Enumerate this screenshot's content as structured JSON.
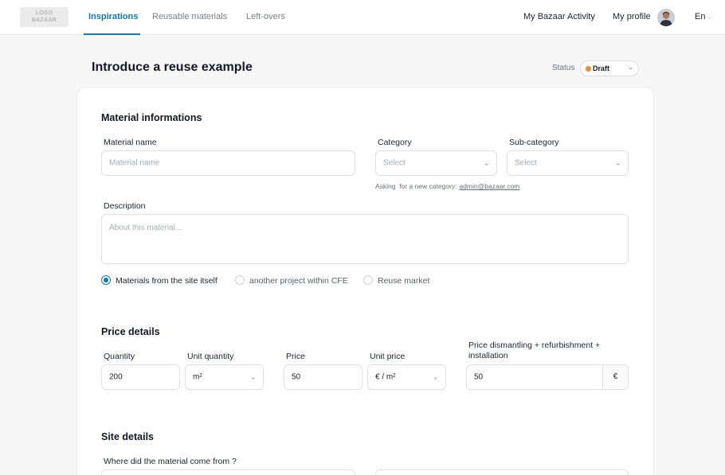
{
  "logo": {
    "line1": "LOGO",
    "line2": "BAZAAR"
  },
  "nav": {
    "tabs": [
      {
        "label": "Inspirations",
        "active": true
      },
      {
        "label": "Reusable materials",
        "active": false
      },
      {
        "label": "Left-overs",
        "active": false
      }
    ],
    "activity": "My Bazaar Activity",
    "profile": "My profile",
    "language": "En"
  },
  "page": {
    "title": "Introduce a reuse example",
    "status_label": "Status",
    "status_value": "Draft",
    "status_color": "#f08a2a"
  },
  "material": {
    "section_title": "Material informations",
    "name_label": "Material name",
    "name_placeholder": "Material name",
    "category_label": "Category",
    "category_placeholder": "Select",
    "subcategory_label": "Sub-category",
    "subcategory_placeholder": "Select",
    "hint_text": "Asking  for a new category:",
    "hint_email": "admin@bazaar.com",
    "description_label": "Description",
    "description_placeholder": "About this material...",
    "origin_options": [
      {
        "label": "Materials from the site itself",
        "checked": true
      },
      {
        "label": "another project within CFE",
        "checked": false
      },
      {
        "label": "Reuse market",
        "checked": false
      }
    ]
  },
  "price": {
    "section_title": "Price details",
    "quantity_label": "Quantity",
    "quantity_value": "200",
    "unit_quantity_label": "Unit quantity",
    "unit_quantity_value": "m²",
    "price_label": "Price",
    "price_value": "50",
    "unit_price_label": "Unit price",
    "unit_price_value": "€ / m²",
    "dismantling_label_line1": "Price dismantling + refurbishment +",
    "dismantling_label_line2": "installation",
    "dismantling_value": "50",
    "currency_suffix": "€"
  },
  "site": {
    "section_title": "Site details",
    "origin_question": "Where did the material come from ?"
  },
  "colors": {
    "accent": "#1479b8"
  }
}
